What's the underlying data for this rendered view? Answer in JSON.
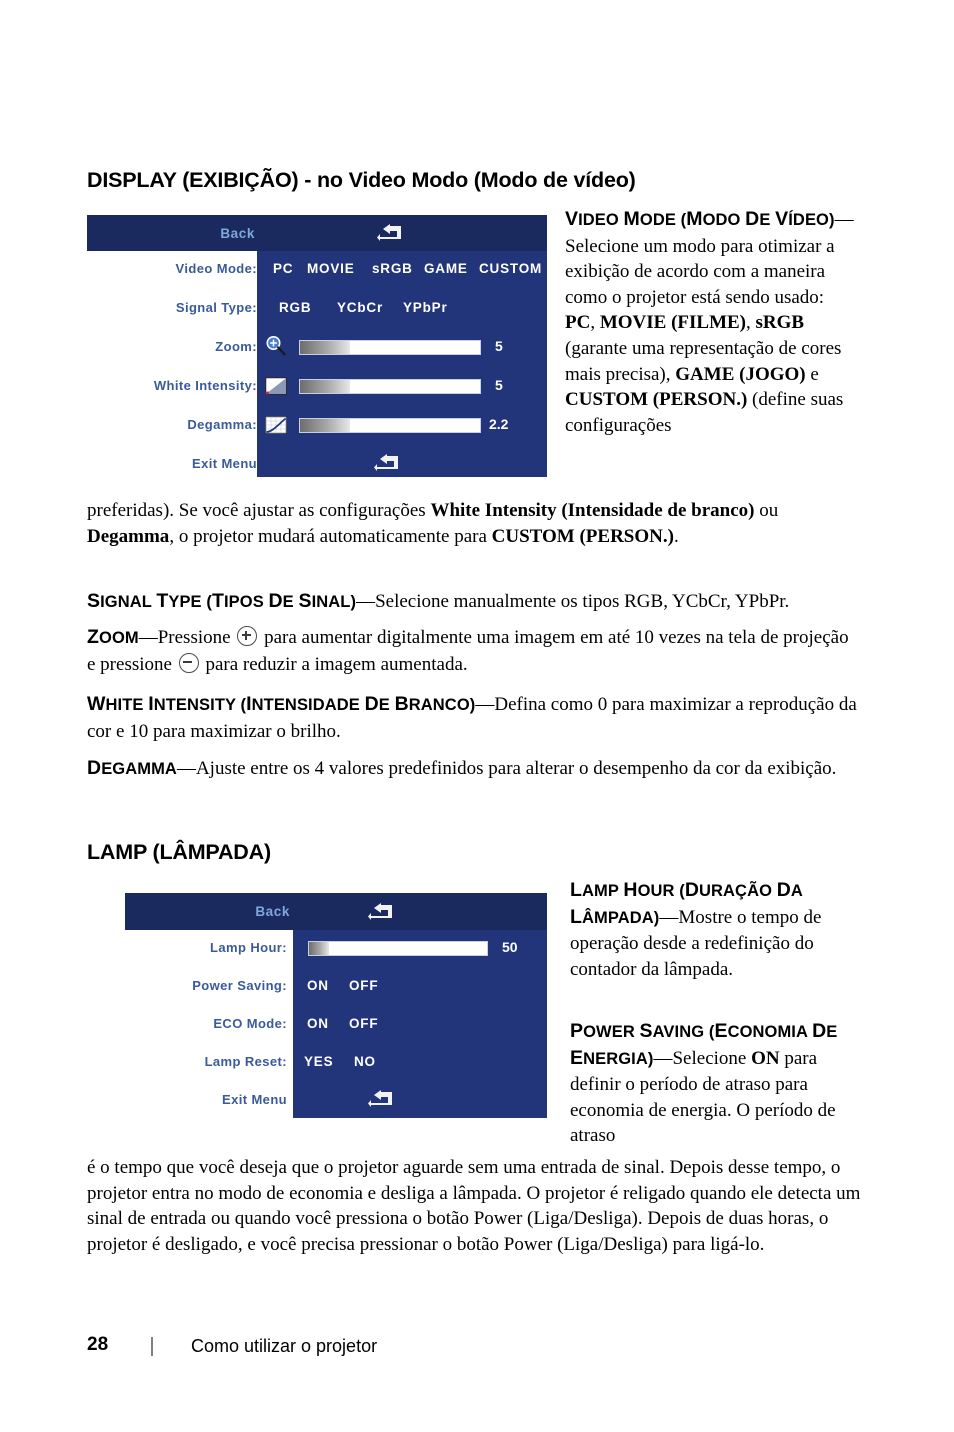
{
  "page": {
    "heading_display": "DISPLAY (EXIBIÇÃO) - no Video Modo (Modo de vídeo)",
    "heading_lamp": "LAMP (LÂMPADA)"
  },
  "osd_display": {
    "back_label": "Back",
    "rows": [
      {
        "label": "Video Mode:",
        "options": [
          "PC",
          "MOVIE",
          "sRGB",
          "GAME",
          "CUSTOM"
        ]
      },
      {
        "label": "Signal Type:",
        "options": [
          "RGB",
          "YCbCr",
          "YPbPr"
        ]
      },
      {
        "label": "Zoom:",
        "icon": "magnifier-plus-icon",
        "value": "5",
        "fill_percent": 28
      },
      {
        "label": "White Intensity:",
        "icon": "white-intensity-icon",
        "value": "5",
        "fill_percent": 28
      },
      {
        "label": "Degamma:",
        "icon": "degamma-curve-icon",
        "value": "2.2",
        "fill_percent": 28
      },
      {
        "label": "Exit Menu"
      }
    ]
  },
  "osd_lamp": {
    "back_label": "Back",
    "rows": [
      {
        "label": "Lamp Hour:",
        "value": "50",
        "fill_percent": 11
      },
      {
        "label": "Power Saving:",
        "options": [
          "ON",
          "OFF"
        ]
      },
      {
        "label": "ECO Mode:",
        "options": [
          "ON",
          "OFF"
        ]
      },
      {
        "label": "Lamp Reset:",
        "options": [
          "YES",
          "NO"
        ]
      },
      {
        "label": "Exit Menu"
      }
    ]
  },
  "body": {
    "video_mode": {
      "term_parts": [
        "V",
        "IDEO ",
        "M",
        "ODE (",
        "M",
        "ODO DE ",
        "VÍDEO)"
      ],
      "term_plain": "VIDEO MODE (MODO DE VÍDEO)",
      "col_text_1": "—Selecione um modo para otimizar a exibição de acordo com a maneira como o projetor está sendo usado: ",
      "col_bold_1": "PC",
      "col_text_2": ", ",
      "col_bold_2": "MOVIE (FILME)",
      "col_text_3": ", ",
      "col_bold_3": "sRGB",
      "col_text_4": " (garante uma representação de cores mais precisa), ",
      "col_bold_4": "GAME (JOGO)",
      "col_text_5": " e ",
      "col_bold_5": "CUSTOM (PERSON.)",
      "col_text_6": " (define suas configurações"
    },
    "video_mode_cont": {
      "text_1": "preferidas). Se você ajustar as configurações ",
      "bold_1": "White Intensity (Intensidade de branco)",
      "text_2": " ou ",
      "bold_2": "Degamma",
      "text_3": ", o projetor mudará automaticamente para ",
      "bold_3": "CUSTOM (PERSON.)",
      "text_4": "."
    },
    "signal_type": {
      "term_plain": "SIGNAL TYPE (TIPOS DE SINAL)",
      "text": "—Selecione manualmente os tipos RGB, YCbCr, YPbPr."
    },
    "zoom": {
      "term_plain": "ZOOM",
      "text_1": "—Pressione ",
      "icon_1": "plus-key-icon",
      "text_2": " para aumentar digitalmente uma imagem em até 10 vezes na tela de projeção e pressione ",
      "icon_2": "minus-key-icon",
      "text_3": " para reduzir a imagem aumentada."
    },
    "white_intensity": {
      "term_plain": "WHITE INTENSITY (INTENSIDADE DE BRANCO)",
      "text": "—Defina como 0 para maximizar a reprodução da cor e 10 para maximizar o brilho."
    },
    "degamma": {
      "term_plain": "DEGAMMA",
      "text": "—Ajuste entre os 4 valores predefinidos para alterar o desempenho da cor da exibição."
    },
    "lamp_hour": {
      "term_plain": "LAMP HOUR (DURAÇÃO DA LÂMPADA)",
      "text": "—Mostre o tempo de operação desde a redefinição do contador da lâmpada."
    },
    "power_saving": {
      "term_plain": "POWER SAVING (ECONOMIA DE ENERGIA)",
      "text_1": "—Selecione ",
      "bold_1": "ON",
      "text_2": " para definir o período de atraso para economia de energia. O período de atraso"
    },
    "power_saving_cont": {
      "text": "é o tempo que você deseja que o projetor aguarde sem uma entrada de sinal. Depois desse tempo, o projetor entra no modo de economia e desliga a lâmpada. O projetor é religado quando ele detecta um sinal de entrada ou quando você pressiona o botão Power (Liga/Desliga). Depois de duas horas, o projetor é desligado, e você precisa pressionar o botão Power (Liga/Desliga) para ligá-lo."
    }
  },
  "footer": {
    "page_number": "28",
    "title": "Como utilizar o projetor"
  },
  "colors": {
    "osd_header_navy": "#1b2a5e",
    "osd_body_navy": "#23357a",
    "osd_label_blue": "#3a5a9c",
    "osd_back_blue": "#7ea8dd",
    "osd_option_white": "#ffffff",
    "page_background": "#ffffff",
    "text_black": "#000000"
  }
}
